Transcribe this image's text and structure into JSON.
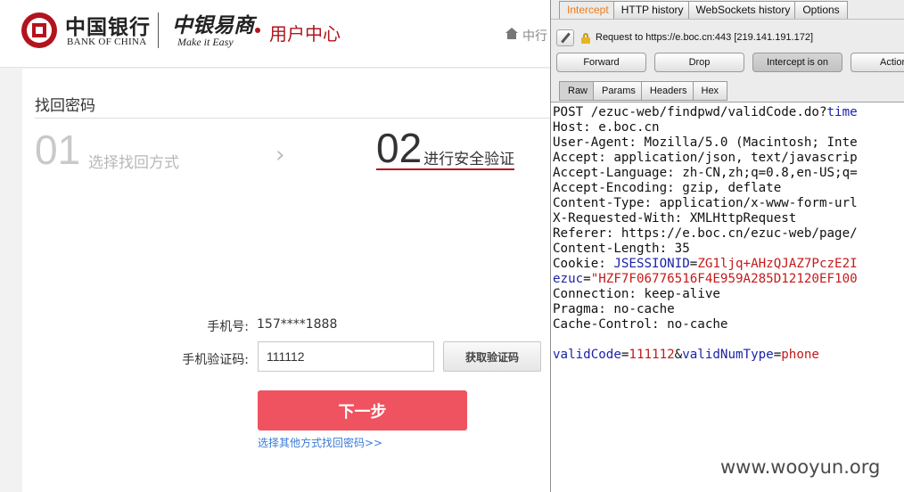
{
  "bank_page": {
    "header": {
      "boc_name_cn": "中国银行",
      "boc_name_en": "BANK OF CHINA",
      "brand_cn": "中银易商",
      "brand_en": "Make it Easy",
      "section_title": "用户中心",
      "nav_link": "中行",
      "brand_color": "#b3131d"
    },
    "page_title": "找回密码",
    "steps": [
      {
        "number": "01",
        "label": "选择找回方式",
        "state": "done"
      },
      {
        "number": "02",
        "label": "进行安全验证",
        "state": "current"
      }
    ],
    "step_separator": "›",
    "form": {
      "phone_label": "手机号:",
      "phone_value": "157****1888",
      "code_label": "手机验证码:",
      "code_value": "111112",
      "get_code_button": "获取验证码",
      "next_button": "下一步",
      "other_methods_link": "选择其他方式找回密码>>",
      "accent_color": "#ef5360"
    }
  },
  "burp": {
    "main_tabs": [
      {
        "label": "Intercept",
        "active": true
      },
      {
        "label": "HTTP history",
        "active": false
      },
      {
        "label": "WebSockets history",
        "active": false
      },
      {
        "label": "Options",
        "active": false
      }
    ],
    "request_line": "Request to https://e.boc.cn:443  [219.141.191.172]",
    "buttons": {
      "forward": "Forward",
      "drop": "Drop",
      "intercept_toggle": "Intercept is on",
      "action": "Action"
    },
    "sub_tabs": [
      {
        "label": "Raw",
        "active": true
      },
      {
        "label": "Params",
        "active": false
      },
      {
        "label": "Headers",
        "active": false
      },
      {
        "label": "Hex",
        "active": false
      }
    ],
    "raw_request": {
      "line_1": "POST /ezuc-web/findpwd/validCode.do?",
      "line_1_param": "time",
      "line_2": "Host: e.boc.cn",
      "line_3": "User-Agent: Mozilla/5.0 (Macintosh; Inte",
      "line_4": "Accept: application/json, text/javascrip",
      "line_5": "Accept-Language: zh-CN,zh;q=0.8,en-US;q=",
      "line_6": "Accept-Encoding: gzip, deflate",
      "line_7": "Content-Type: application/x-www-form-url",
      "line_8": "X-Requested-With: XMLHttpRequest",
      "line_9": "Referer: https://e.boc.cn/ezuc-web/page/",
      "line_10": "Content-Length: 35",
      "cookie_label": "Cookie: ",
      "cookie_1_name": "JSESSIONID",
      "cookie_1_value": "ZG1ljq+AHzQJAZ7PczE2I",
      "cookie_2_name": "ezuc",
      "cookie_2_value": "\"HZF7F06776516F4E959A285D12120EF100",
      "line_13": "Connection: keep-alive",
      "line_14": "Pragma: no-cache",
      "line_15": "Cache-Control: no-cache",
      "body_param_1": "validCode",
      "body_value_1": "111112",
      "body_param_2": "validNumType",
      "body_value_2": "phone"
    },
    "colors": {
      "active_tab": "#f07a1a",
      "param_key": "#1a23a8",
      "param_value": "#c41a1a"
    }
  },
  "watermark": "www.wooyun.org"
}
